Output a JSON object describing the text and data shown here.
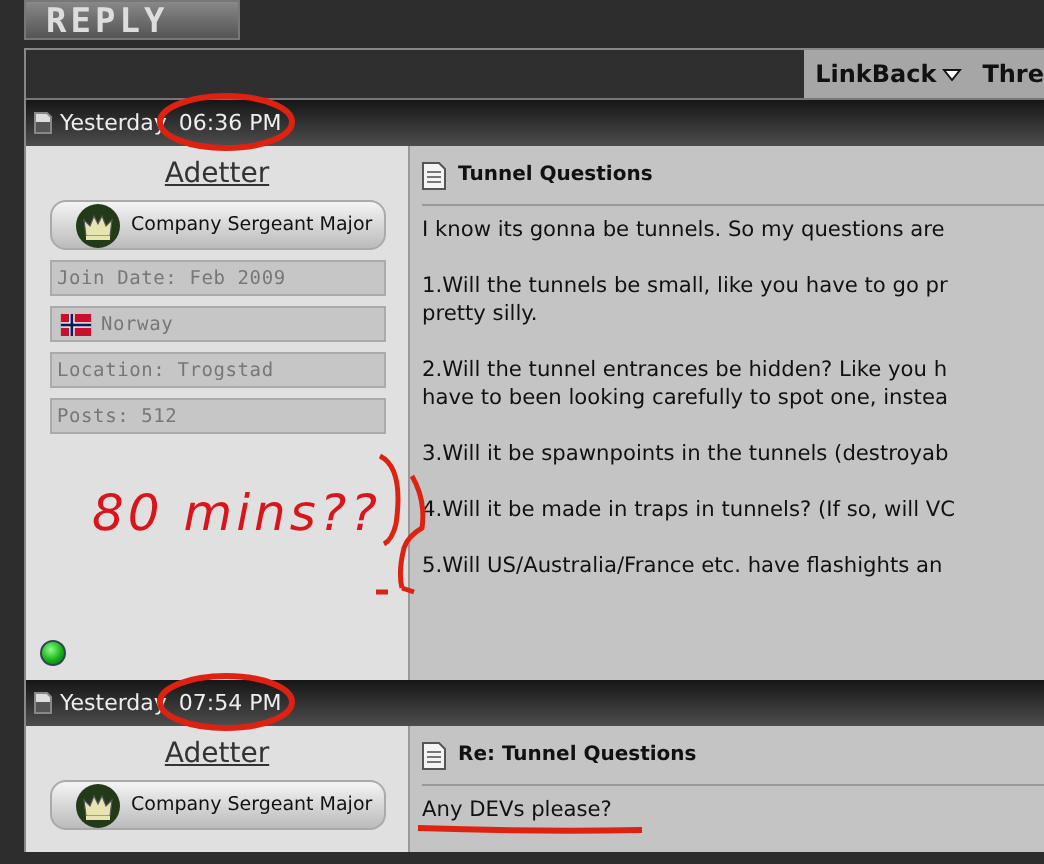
{
  "reply_button": "REPLY",
  "thread_bar": {
    "links": [
      {
        "label": "LinkBack",
        "dropdown": true
      },
      {
        "label": "Thre",
        "dropdown": false
      }
    ]
  },
  "posts": [
    {
      "day": "Yesterday",
      "time": "06:36 PM",
      "time_circled": true,
      "author": "Adetter",
      "rank": "Company Sergeant Major",
      "info": [
        {
          "kind": "text",
          "text": "Join Date: Feb 2009"
        },
        {
          "kind": "flag",
          "text": "Norway"
        },
        {
          "kind": "text",
          "text": "Location: Trogstad"
        },
        {
          "kind": "text",
          "text": "Posts: 512"
        }
      ],
      "online": true,
      "title": "Tunnel Questions",
      "paragraphs": [
        {
          "lines": [
            "I know its gonna be tunnels. So my questions are"
          ],
          "underlined": false
        },
        {
          "lines": [
            "1.Will the tunnels be small, like you have to go pr",
            "pretty silly."
          ],
          "underlined": false
        },
        {
          "lines": [
            "2.Will the tunnel entrances be hidden? Like you h",
            "have to been looking carefully to spot one, instea"
          ],
          "underlined": false
        },
        {
          "lines": [
            "3.Will it be spawnpoints in the tunnels (destroyab"
          ],
          "underlined": false
        },
        {
          "lines": [
            "4.Will it be made in traps in tunnels? (If so, will VC"
          ],
          "underlined": false
        },
        {
          "lines": [
            "5.Will US/Australia/France etc. have flashights an"
          ],
          "underlined": false
        }
      ]
    },
    {
      "day": "Yesterday",
      "time": "07:54 PM",
      "time_circled": true,
      "author": "Adetter",
      "rank": "Company Sergeant Major",
      "title": "Re: Tunnel Questions",
      "paragraphs": [
        {
          "lines": [
            "Any DEVs please?"
          ],
          "underlined": true
        }
      ]
    }
  ],
  "annotations": {
    "note": "80 mins??"
  }
}
